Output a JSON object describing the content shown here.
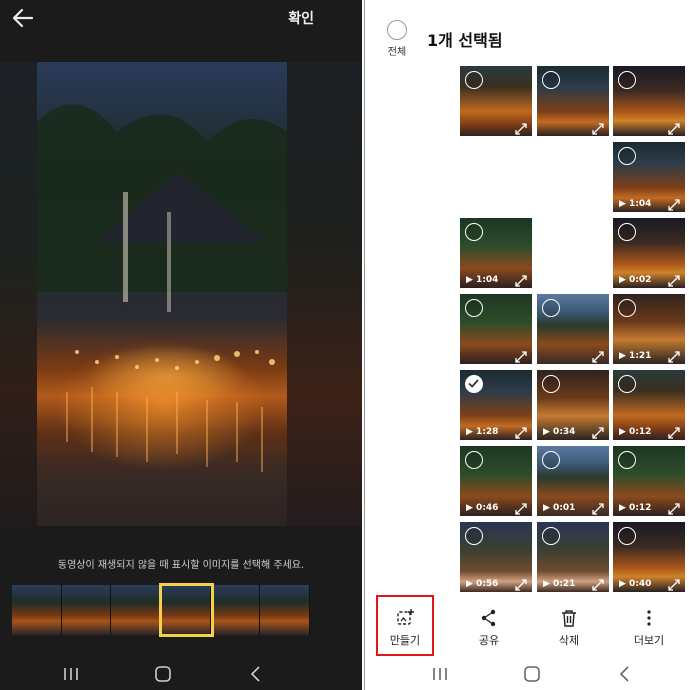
{
  "left": {
    "confirm_label": "확인",
    "hint": "동영상이 재생되지 않을 때 표시할 이미지를 선택해 주세요.",
    "strip_frames": 6,
    "selected_frame_index": 3,
    "selected_color": "#f2d24b"
  },
  "right": {
    "select_all_label": "전체",
    "title": "1개 선택됨",
    "grid": [
      {
        "dur": "",
        "selected": false,
        "video": false,
        "bg": "bg-a"
      },
      {
        "dur": "",
        "selected": false,
        "video": false,
        "bg": "bg-b"
      },
      {
        "dur": "",
        "selected": false,
        "video": false,
        "bg": "bg-e"
      },
      {
        "dur": "1:04",
        "selected": false,
        "video": true,
        "bg": "bg-b"
      },
      {
        "dur": "1:04",
        "selected": false,
        "video": true,
        "bg": "bg-c"
      },
      {
        "dur": "0:02",
        "selected": false,
        "video": true,
        "bg": "bg-e"
      },
      {
        "dur": "",
        "selected": false,
        "video": false,
        "bg": "bg-c"
      },
      {
        "dur": "",
        "selected": false,
        "video": false,
        "bg": "bg-d"
      },
      {
        "dur": "1:21",
        "selected": false,
        "video": true,
        "bg": "bg-f"
      },
      {
        "dur": "1:28",
        "selected": true,
        "video": true,
        "bg": "bg-b"
      },
      {
        "dur": "0:34",
        "selected": false,
        "video": true,
        "bg": "bg-f"
      },
      {
        "dur": "0:12",
        "selected": false,
        "video": true,
        "bg": "bg-a"
      },
      {
        "dur": "0:46",
        "selected": false,
        "video": true,
        "bg": "bg-c"
      },
      {
        "dur": "0:01",
        "selected": false,
        "video": true,
        "bg": "bg-d"
      },
      {
        "dur": "0:12",
        "selected": false,
        "video": true,
        "bg": "bg-c"
      },
      {
        "dur": "0:56",
        "selected": false,
        "video": true,
        "bg": "bg-g"
      },
      {
        "dur": "0:21",
        "selected": false,
        "video": true,
        "bg": "bg-g"
      },
      {
        "dur": "0:40",
        "selected": false,
        "video": true,
        "bg": "bg-e"
      }
    ],
    "actions": {
      "make": "만들기",
      "share": "공유",
      "delete": "삭제",
      "more": "더보기"
    },
    "highlight_color": "#e4141b"
  }
}
